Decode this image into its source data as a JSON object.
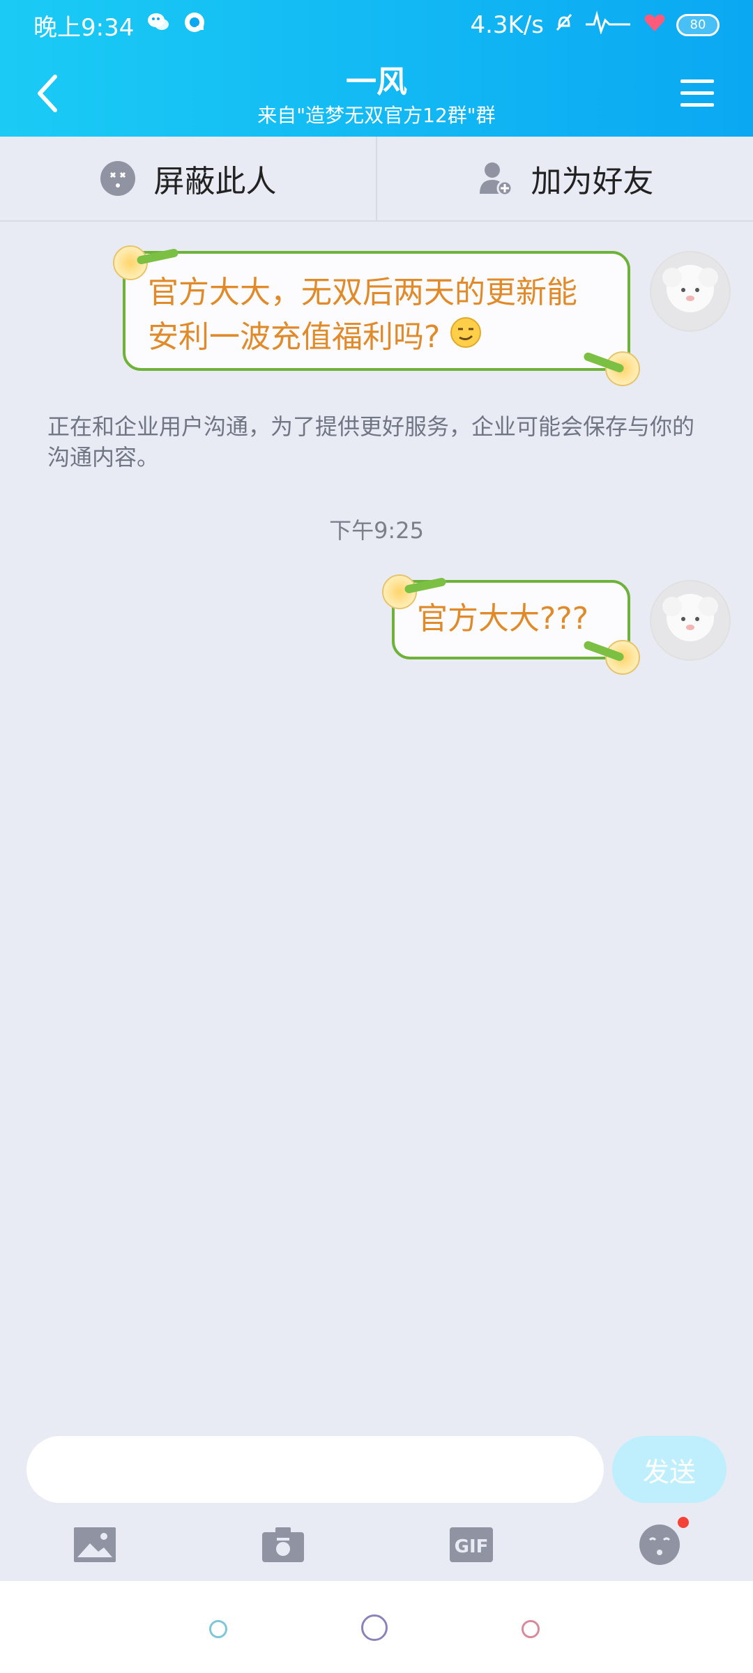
{
  "status_bar": {
    "time": "晚上9:34",
    "network_speed": "4.3K/s",
    "battery": "80",
    "icons": [
      "wechat-icon",
      "qq-icon",
      "mute-bell-icon",
      "hd-signal-icon",
      "heart-icon",
      "battery-icon"
    ]
  },
  "header": {
    "title": "一风",
    "subtitle": "来自\"造梦无双官方12群\"群"
  },
  "actions": {
    "block_label": "屏蔽此人",
    "add_friend_label": "加为好友"
  },
  "messages": [
    {
      "text": "官方大大，无双后两天的更新能安利一波充值福利吗?",
      "emoji": "smirk-emoji"
    },
    {
      "text": "官方大大???"
    }
  ],
  "system_notice": "正在和企业用户沟通，为了提供更好服务，企业可能会保存与你的沟通内容。",
  "timestamp": "下午9:25",
  "input": {
    "placeholder": "",
    "send_label": "发送"
  },
  "toolbar": [
    "image-icon",
    "camera-icon",
    "gif-icon",
    "emoji-icon"
  ],
  "colors": {
    "header_start": "#1BCBF5",
    "header_end": "#0AA8F2",
    "bubble_text": "#E08A2A",
    "bubble_border": "#6FB23A",
    "send_button": "#BFEFFC"
  }
}
